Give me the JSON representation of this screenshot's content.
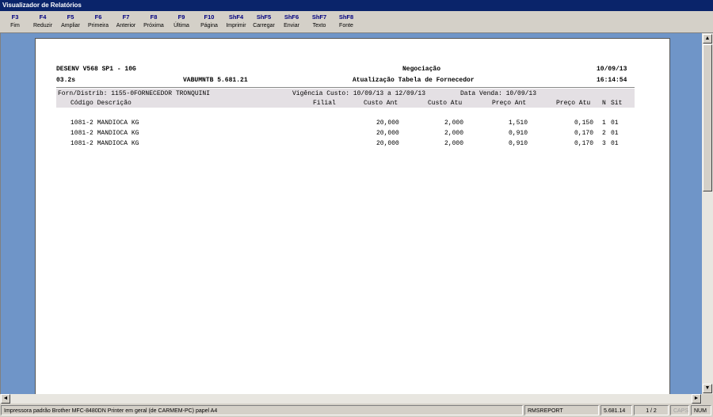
{
  "window": {
    "title": "Visualizador de Relatórios"
  },
  "toolbar": [
    {
      "key": "F3",
      "label": "Fim"
    },
    {
      "key": "F4",
      "label": "Reduzir"
    },
    {
      "key": "F5",
      "label": "Ampliar"
    },
    {
      "key": "F6",
      "label": "Primeira"
    },
    {
      "key": "F7",
      "label": "Anterior"
    },
    {
      "key": "F8",
      "label": "Próxima"
    },
    {
      "key": "F9",
      "label": "Última"
    },
    {
      "key": "F10",
      "label": "Página"
    },
    {
      "key": "ShF4",
      "label": "Imprimir"
    },
    {
      "key": "ShF5",
      "label": "Carregar"
    },
    {
      "key": "ShF6",
      "label": "Enviar"
    },
    {
      "key": "ShF7",
      "label": "Texto"
    },
    {
      "key": "ShF8",
      "label": "Fonte"
    }
  ],
  "report": {
    "header": {
      "env": "DESENV V568 SP1 - 10G",
      "title1": "Negociação",
      "date": "10/09/13",
      "version": "03.2s",
      "program": "VABUMNTB 5.681.21",
      "title2": "Atualização Tabela de Fornecedor",
      "time": "16:14:54"
    },
    "filter": {
      "supplier": "Forn/Distrib: 1155-0FORNECEDOR TRONQUINI",
      "validity": "Vigência Custo: 10/09/13 a 12/09/13",
      "sale_date": "Data Venda: 10/09/13"
    },
    "columns": {
      "code_desc": "Código Descrição",
      "branch": "Filial",
      "cost_prev": "Custo Ant",
      "cost_curr": "Custo Atu",
      "price_prev": "Preço Ant",
      "price_curr": "Preço Atu",
      "n": "N",
      "sit": "Sit"
    },
    "rows": [
      {
        "code_desc": "1081-2 MANDIOCA KG",
        "cost_prev": "20,000",
        "cost_curr": "2,000",
        "price_prev": "1,510",
        "price_curr": "0,150",
        "n": "1",
        "sit": "01"
      },
      {
        "code_desc": "1081-2 MANDIOCA KG",
        "cost_prev": "20,000",
        "cost_curr": "2,000",
        "price_prev": "0,910",
        "price_curr": "0,170",
        "n": "2",
        "sit": "01"
      },
      {
        "code_desc": "1081-2 MANDIOCA KG",
        "cost_prev": "20,000",
        "cost_curr": "2,000",
        "price_prev": "0,910",
        "price_curr": "0,170",
        "n": "3",
        "sit": "01"
      }
    ]
  },
  "status": {
    "printer": "Impressora padrão Brother MFC-8480DN Printer em geral (de CARMEM-PC) papel A4",
    "module": "RMSREPORT",
    "version": "5.681.14",
    "page": "1 / 2",
    "caps": "CAPS",
    "num": "NUM"
  }
}
